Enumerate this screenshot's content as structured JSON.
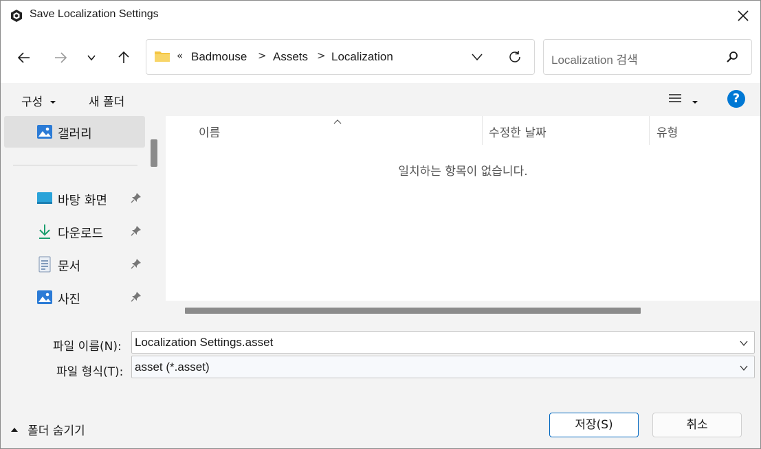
{
  "window": {
    "title": "Save Localization Settings"
  },
  "nav": {
    "breadcrumb": {
      "overflow": "«",
      "items": [
        "Badmouse",
        "Assets",
        "Localization"
      ],
      "separator": ">"
    },
    "search_placeholder": "Localization 검색"
  },
  "command_bar": {
    "organize_label": "구성",
    "new_folder_label": "새 폴더",
    "help_label": "?"
  },
  "sidebar": {
    "items": [
      {
        "label": "갤러리",
        "icon": "gallery-icon",
        "pinned": false,
        "selected": true
      },
      {
        "label": "바탕 화면",
        "icon": "desktop-icon",
        "pinned": true
      },
      {
        "label": "다운로드",
        "icon": "download-icon",
        "pinned": true
      },
      {
        "label": "문서",
        "icon": "document-icon",
        "pinned": true
      },
      {
        "label": "사진",
        "icon": "pictures-icon",
        "pinned": true
      }
    ]
  },
  "content": {
    "columns": [
      "이름",
      "수정한 날짜",
      "유형"
    ],
    "empty_message": "일치하는 항목이 없습니다."
  },
  "form": {
    "filename_label": "파일 이름(N):",
    "filename_value": "Localization Settings.asset",
    "filetype_label": "파일 형식(T):",
    "filetype_value": "asset (*.asset)"
  },
  "footer": {
    "hide_folders_label": "폴더 숨기기",
    "save_label": "저장(S)",
    "cancel_label": "취소"
  },
  "colors": {
    "accent": "#0067c0",
    "help": "#0078d4",
    "folder": "#f4c542",
    "download": "#1a9e6e"
  }
}
